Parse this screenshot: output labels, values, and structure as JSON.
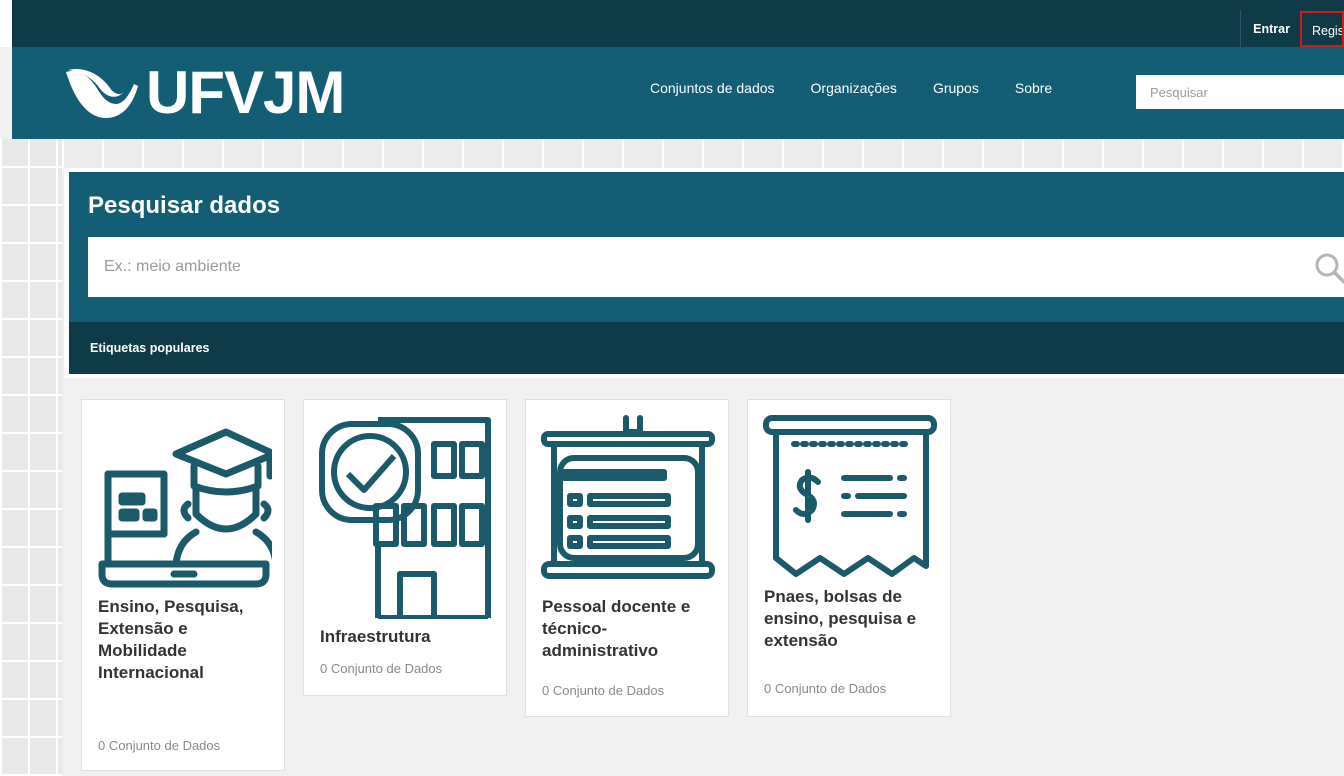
{
  "account": {
    "login": "Entrar",
    "register": "Registrar"
  },
  "logo": {
    "text": "UFVJM"
  },
  "nav": {
    "items": [
      "Conjuntos de dados",
      "Organizações",
      "Grupos",
      "Sobre"
    ],
    "search_placeholder": "Pesquisar"
  },
  "hero": {
    "title": "Pesquisar dados",
    "search_placeholder": "Ex.: meio ambiente",
    "tags_label": "Etiquetas populares"
  },
  "groups": [
    {
      "title": "Ensino, Pesquisa, Extensão e Mobilidade Internacional",
      "count": "0 Conjunto de Dados",
      "icon": "graduation-laptop-icon"
    },
    {
      "title": "Infraestrutura",
      "count": "0 Conjunto de Dados",
      "icon": "building-check-icon"
    },
    {
      "title": "Pessoal docente e técnico-administrativo",
      "count": "0 Conjunto de Dados",
      "icon": "presentation-board-icon"
    },
    {
      "title": "Pnaes, bolsas de ensino, pesquisa e extensão",
      "count": "0 Conjunto de Dados",
      "icon": "receipt-dollar-icon"
    }
  ],
  "colors": {
    "primary": "#135e74",
    "dark": "#0e3b47",
    "icon": "#1b5a6b"
  }
}
